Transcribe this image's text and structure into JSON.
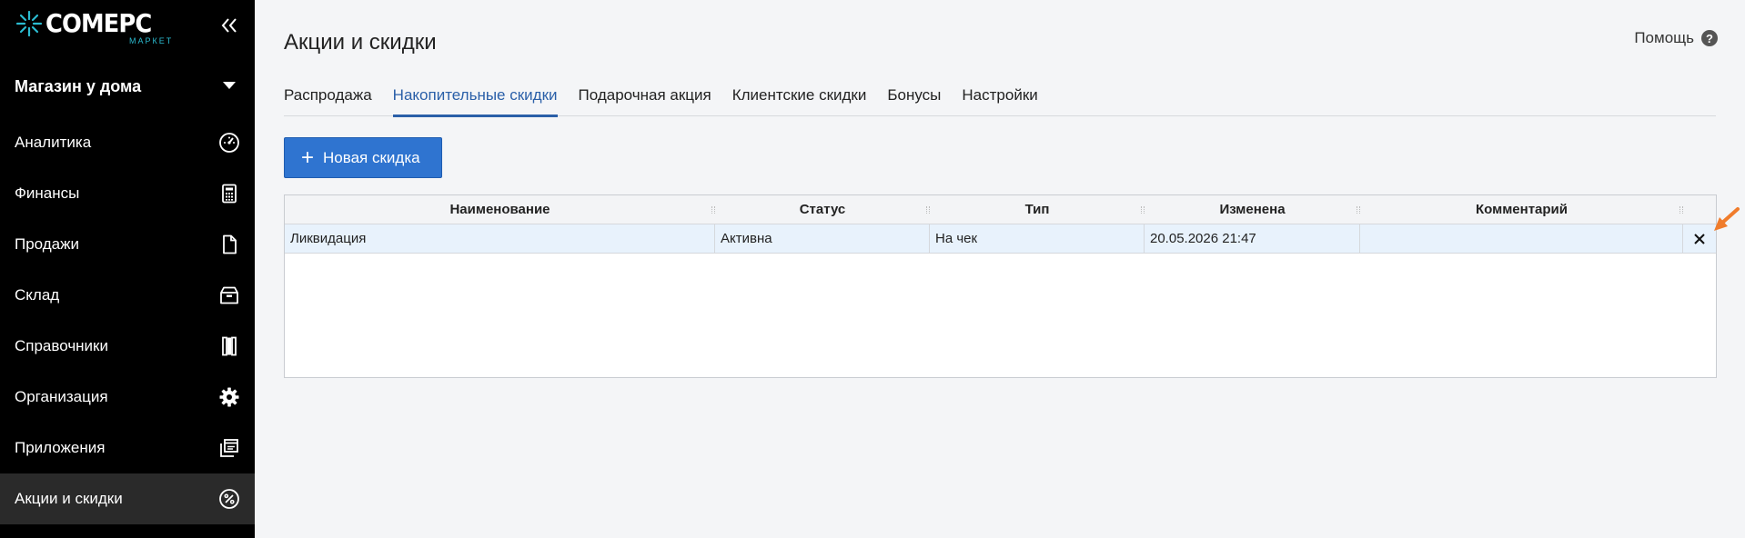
{
  "app": {
    "logo_main": "COMEPC",
    "logo_sub": "МАРКЕТ"
  },
  "sidebar": {
    "store": "Магазин у дома",
    "items": [
      {
        "label": "Аналитика",
        "icon": "speedometer-icon"
      },
      {
        "label": "Финансы",
        "icon": "calculator-icon"
      },
      {
        "label": "Продажи",
        "icon": "document-icon"
      },
      {
        "label": "Склад",
        "icon": "box-icon"
      },
      {
        "label": "Справочники",
        "icon": "books-icon"
      },
      {
        "label": "Организация",
        "icon": "gear-icon"
      },
      {
        "label": "Приложения",
        "icon": "windows-icon"
      },
      {
        "label": "Акции и скидки",
        "icon": "percent-icon",
        "active": true
      }
    ]
  },
  "page": {
    "title": "Акции и скидки",
    "help": "Помощь"
  },
  "tabs": [
    "Распродажа",
    "Накопительные скидки",
    "Подарочная акция",
    "Клиентские скидки",
    "Бонусы",
    "Настройки"
  ],
  "active_tab": "Накопительные скидки",
  "toolbar": {
    "new_button": "Новая скидка"
  },
  "table": {
    "columns": [
      "Наименование",
      "Статус",
      "Тип",
      "Изменена",
      "Комментарий"
    ],
    "rows": [
      {
        "name": "Ликвидация",
        "status": "Активна",
        "type": "На чек",
        "changed": "20.05.2026 21:47",
        "comment": ""
      }
    ]
  },
  "colors": {
    "accent": "#2f74d0",
    "tab_active": "#2a5fa8",
    "logo_accent": "#2bbbd0",
    "sidebar_bg": "#000000",
    "pointer_arrow": "#f07c2c"
  }
}
